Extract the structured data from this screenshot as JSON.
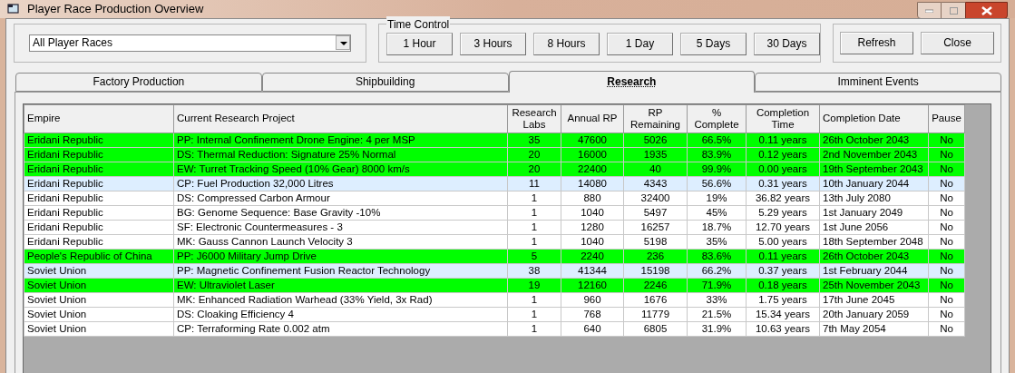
{
  "window": {
    "title": "Player Race Production Overview"
  },
  "race_filter": {
    "value": "All Player Races"
  },
  "time_control": {
    "label": "Time Control",
    "buttons": [
      "1 Hour",
      "3 Hours",
      "8 Hours",
      "1 Day",
      "5 Days",
      "30 Days"
    ]
  },
  "actions": [
    "Refresh",
    "Close"
  ],
  "tabs": [
    {
      "label": "Factory Production",
      "selected": false
    },
    {
      "label": "Shipbuilding",
      "selected": false
    },
    {
      "label": "Research",
      "selected": true
    },
    {
      "label": "Imminent Events",
      "selected": false
    }
  ],
  "table": {
    "columns": [
      "Empire",
      "Current Research Project",
      "Research Labs",
      "Annual RP",
      "RP Remaining",
      "% Complete",
      "Completion Time",
      "Completion Date",
      "Pause"
    ],
    "rows": [
      {
        "color": "#00ff00",
        "cells": [
          "Eridani Republic",
          "PP: Internal Confinement Drone Engine: 4 per MSP",
          "35",
          "47600",
          "5026",
          "66.5%",
          "0.11 years",
          "26th October 2043",
          "No"
        ]
      },
      {
        "color": "#00ff00",
        "cells": [
          "Eridani Republic",
          "DS: Thermal Reduction: Signature 25% Normal",
          "20",
          "16000",
          "1935",
          "83.9%",
          "0.12 years",
          "2nd November 2043",
          "No"
        ]
      },
      {
        "color": "#00ff00",
        "cells": [
          "Eridani Republic",
          "EW: Turret Tracking Speed (10% Gear) 8000 km/s",
          "20",
          "22400",
          "40",
          "99.9%",
          "0.00 years",
          "19th September 2043",
          "No"
        ]
      },
      {
        "color": "#ddeeff",
        "cells": [
          "Eridani Republic",
          "CP: Fuel Production 32,000 Litres",
          "11",
          "14080",
          "4343",
          "56.6%",
          "0.31 years",
          "10th January 2044",
          "No"
        ]
      },
      {
        "color": "#ffffff",
        "cells": [
          "Eridani Republic",
          "DS: Compressed Carbon Armour",
          "1",
          "880",
          "32400",
          "19%",
          "36.82 years",
          "13th July 2080",
          "No"
        ]
      },
      {
        "color": "#ffffff",
        "cells": [
          "Eridani Republic",
          "BG: Genome Sequence: Base Gravity -10%",
          "1",
          "1040",
          "5497",
          "45%",
          "5.29 years",
          "1st January 2049",
          "No"
        ]
      },
      {
        "color": "#ffffff",
        "cells": [
          "Eridani Republic",
          "SF: Electronic Countermeasures - 3",
          "1",
          "1280",
          "16257",
          "18.7%",
          "12.70 years",
          "1st June 2056",
          "No"
        ]
      },
      {
        "color": "#ffffff",
        "cells": [
          "Eridani Republic",
          "MK: Gauss Cannon Launch Velocity 3",
          "1",
          "1040",
          "5198",
          "35%",
          "5.00 years",
          "18th September 2048",
          "No"
        ]
      },
      {
        "color": "#00ff00",
        "cells": [
          "People's Republic of China",
          "PP: J6000 Military Jump Drive",
          "5",
          "2240",
          "236",
          "83.6%",
          "0.11 years",
          "26th October 2043",
          "No"
        ]
      },
      {
        "color": "#ddeeff",
        "cells": [
          "Soviet Union",
          "PP: Magnetic Confinement Fusion Reactor Technology",
          "38",
          "41344",
          "15198",
          "66.2%",
          "0.37 years",
          "1st February 2044",
          "No"
        ]
      },
      {
        "color": "#00ff00",
        "cells": [
          "Soviet Union",
          "EW: Ultraviolet Laser",
          "19",
          "12160",
          "2246",
          "71.9%",
          "0.18 years",
          "25th November 2043",
          "No"
        ]
      },
      {
        "color": "#ffffff",
        "cells": [
          "Soviet Union",
          "MK: Enhanced Radiation Warhead (33% Yield, 3x Rad)",
          "1",
          "960",
          "1676",
          "33%",
          "1.75 years",
          "17th June 2045",
          "No"
        ]
      },
      {
        "color": "#ffffff",
        "cells": [
          "Soviet Union",
          "DS: Cloaking Efficiency 4",
          "1",
          "768",
          "11779",
          "21.5%",
          "15.34 years",
          "20th January 2059",
          "No"
        ]
      },
      {
        "color": "#ffffff",
        "cells": [
          "Soviet Union",
          "CP: Terraforming Rate 0.002 atm",
          "1",
          "640",
          "6805",
          "31.9%",
          "10.63 years",
          "7th May 2054",
          "No"
        ]
      }
    ]
  }
}
